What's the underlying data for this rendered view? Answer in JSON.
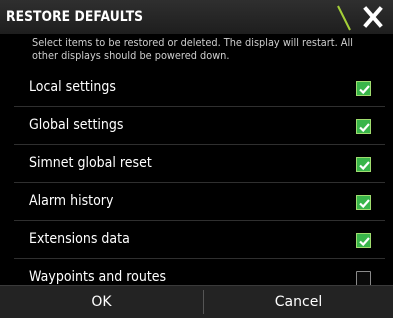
{
  "dialog": {
    "title": "RESTORE DEFAULTS",
    "description": "Select items to be restored or deleted. The display will restart. All other displays should be powered down.",
    "close_icon": "close-icon"
  },
  "items": [
    {
      "label": "Local settings",
      "checked": true
    },
    {
      "label": "Global settings",
      "checked": true
    },
    {
      "label": "Simnet global reset",
      "checked": true
    },
    {
      "label": "Alarm history",
      "checked": true
    },
    {
      "label": "Extensions data",
      "checked": true
    },
    {
      "label": "Waypoints and routes",
      "checked": false
    }
  ],
  "footer": {
    "ok_label": "OK",
    "cancel_label": "Cancel"
  },
  "colors": {
    "accent_green": "#39b54a",
    "header_stripe": "#a4cf38",
    "background": "#000000"
  }
}
